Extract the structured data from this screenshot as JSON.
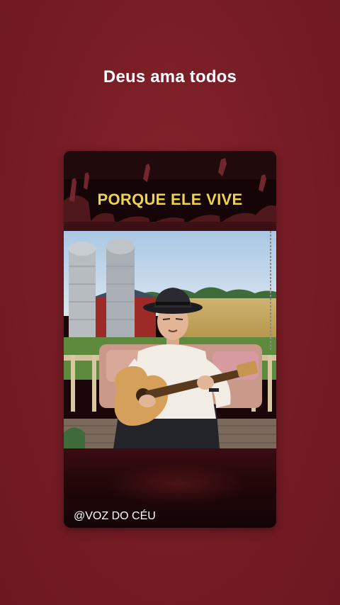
{
  "page": {
    "title": "Deus ama todos"
  },
  "video": {
    "banner_text": "PORQUE ELE VIVE",
    "handle": "@VOZ DO CÉU"
  },
  "colors": {
    "background": "#7a1f27",
    "banner_text": "#f0d34a",
    "handle_text": "#ffffff"
  }
}
